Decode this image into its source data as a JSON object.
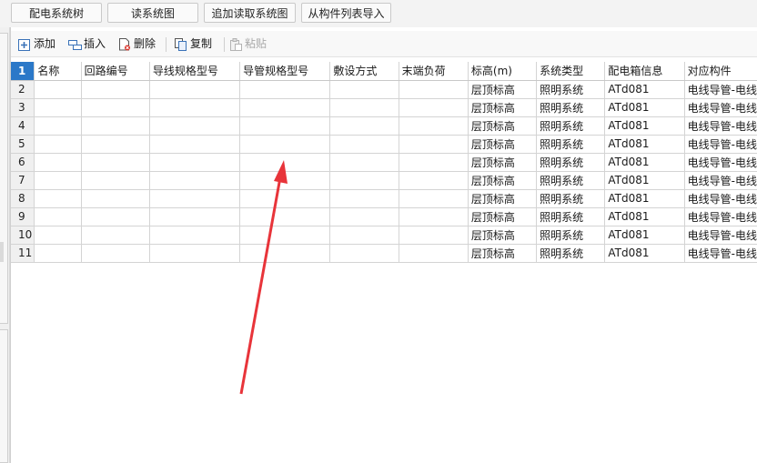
{
  "top_buttons": [
    "配电系统树",
    "读系统图",
    "追加读取系统图",
    "从构件列表导入"
  ],
  "toolbar": {
    "add": "添加",
    "insert": "插入",
    "delete": "删除",
    "copy": "复制",
    "paste": "粘贴"
  },
  "grid": {
    "header_row_number": "1",
    "columns": [
      "名称",
      "回路编号",
      "导线规格型号",
      "导管规格型号",
      "敷设方式",
      "末端负荷",
      "标高(m)",
      "系统类型",
      "配电箱信息",
      "对应构件"
    ],
    "rows": [
      {
        "num": "2",
        "cells": [
          "",
          "",
          "",
          "",
          "",
          "",
          "层顶标高",
          "照明系统",
          "ATd081",
          "电线导管-电线"
        ]
      },
      {
        "num": "3",
        "cells": [
          "",
          "",
          "",
          "",
          "",
          "",
          "层顶标高",
          "照明系统",
          "ATd081",
          "电线导管-电线"
        ]
      },
      {
        "num": "4",
        "cells": [
          "",
          "",
          "",
          "",
          "",
          "",
          "层顶标高",
          "照明系统",
          "ATd081",
          "电线导管-电线"
        ]
      },
      {
        "num": "5",
        "cells": [
          "",
          "",
          "",
          "",
          "",
          "",
          "层顶标高",
          "照明系统",
          "ATd081",
          "电线导管-电线"
        ]
      },
      {
        "num": "6",
        "cells": [
          "",
          "",
          "",
          "",
          "",
          "",
          "层顶标高",
          "照明系统",
          "ATd081",
          "电线导管-电线"
        ]
      },
      {
        "num": "7",
        "cells": [
          "",
          "",
          "",
          "",
          "",
          "",
          "层顶标高",
          "照明系统",
          "ATd081",
          "电线导管-电线"
        ]
      },
      {
        "num": "8",
        "cells": [
          "",
          "",
          "",
          "",
          "",
          "",
          "层顶标高",
          "照明系统",
          "ATd081",
          "电线导管-电线"
        ]
      },
      {
        "num": "9",
        "cells": [
          "",
          "",
          "",
          "",
          "",
          "",
          "层顶标高",
          "照明系统",
          "ATd081",
          "电线导管-电线"
        ]
      },
      {
        "num": "10",
        "cells": [
          "",
          "",
          "",
          "",
          "",
          "",
          "层顶标高",
          "照明系统",
          "ATd081",
          "电线导管-电线"
        ]
      },
      {
        "num": "11",
        "cells": [
          "",
          "",
          "",
          "",
          "",
          "",
          "层顶标高",
          "照明系统",
          "ATd081",
          "电线导管-电线"
        ]
      }
    ]
  },
  "colors": {
    "selected_row_number": "#2b78c8",
    "annotation_arrow": "#e8343a"
  }
}
